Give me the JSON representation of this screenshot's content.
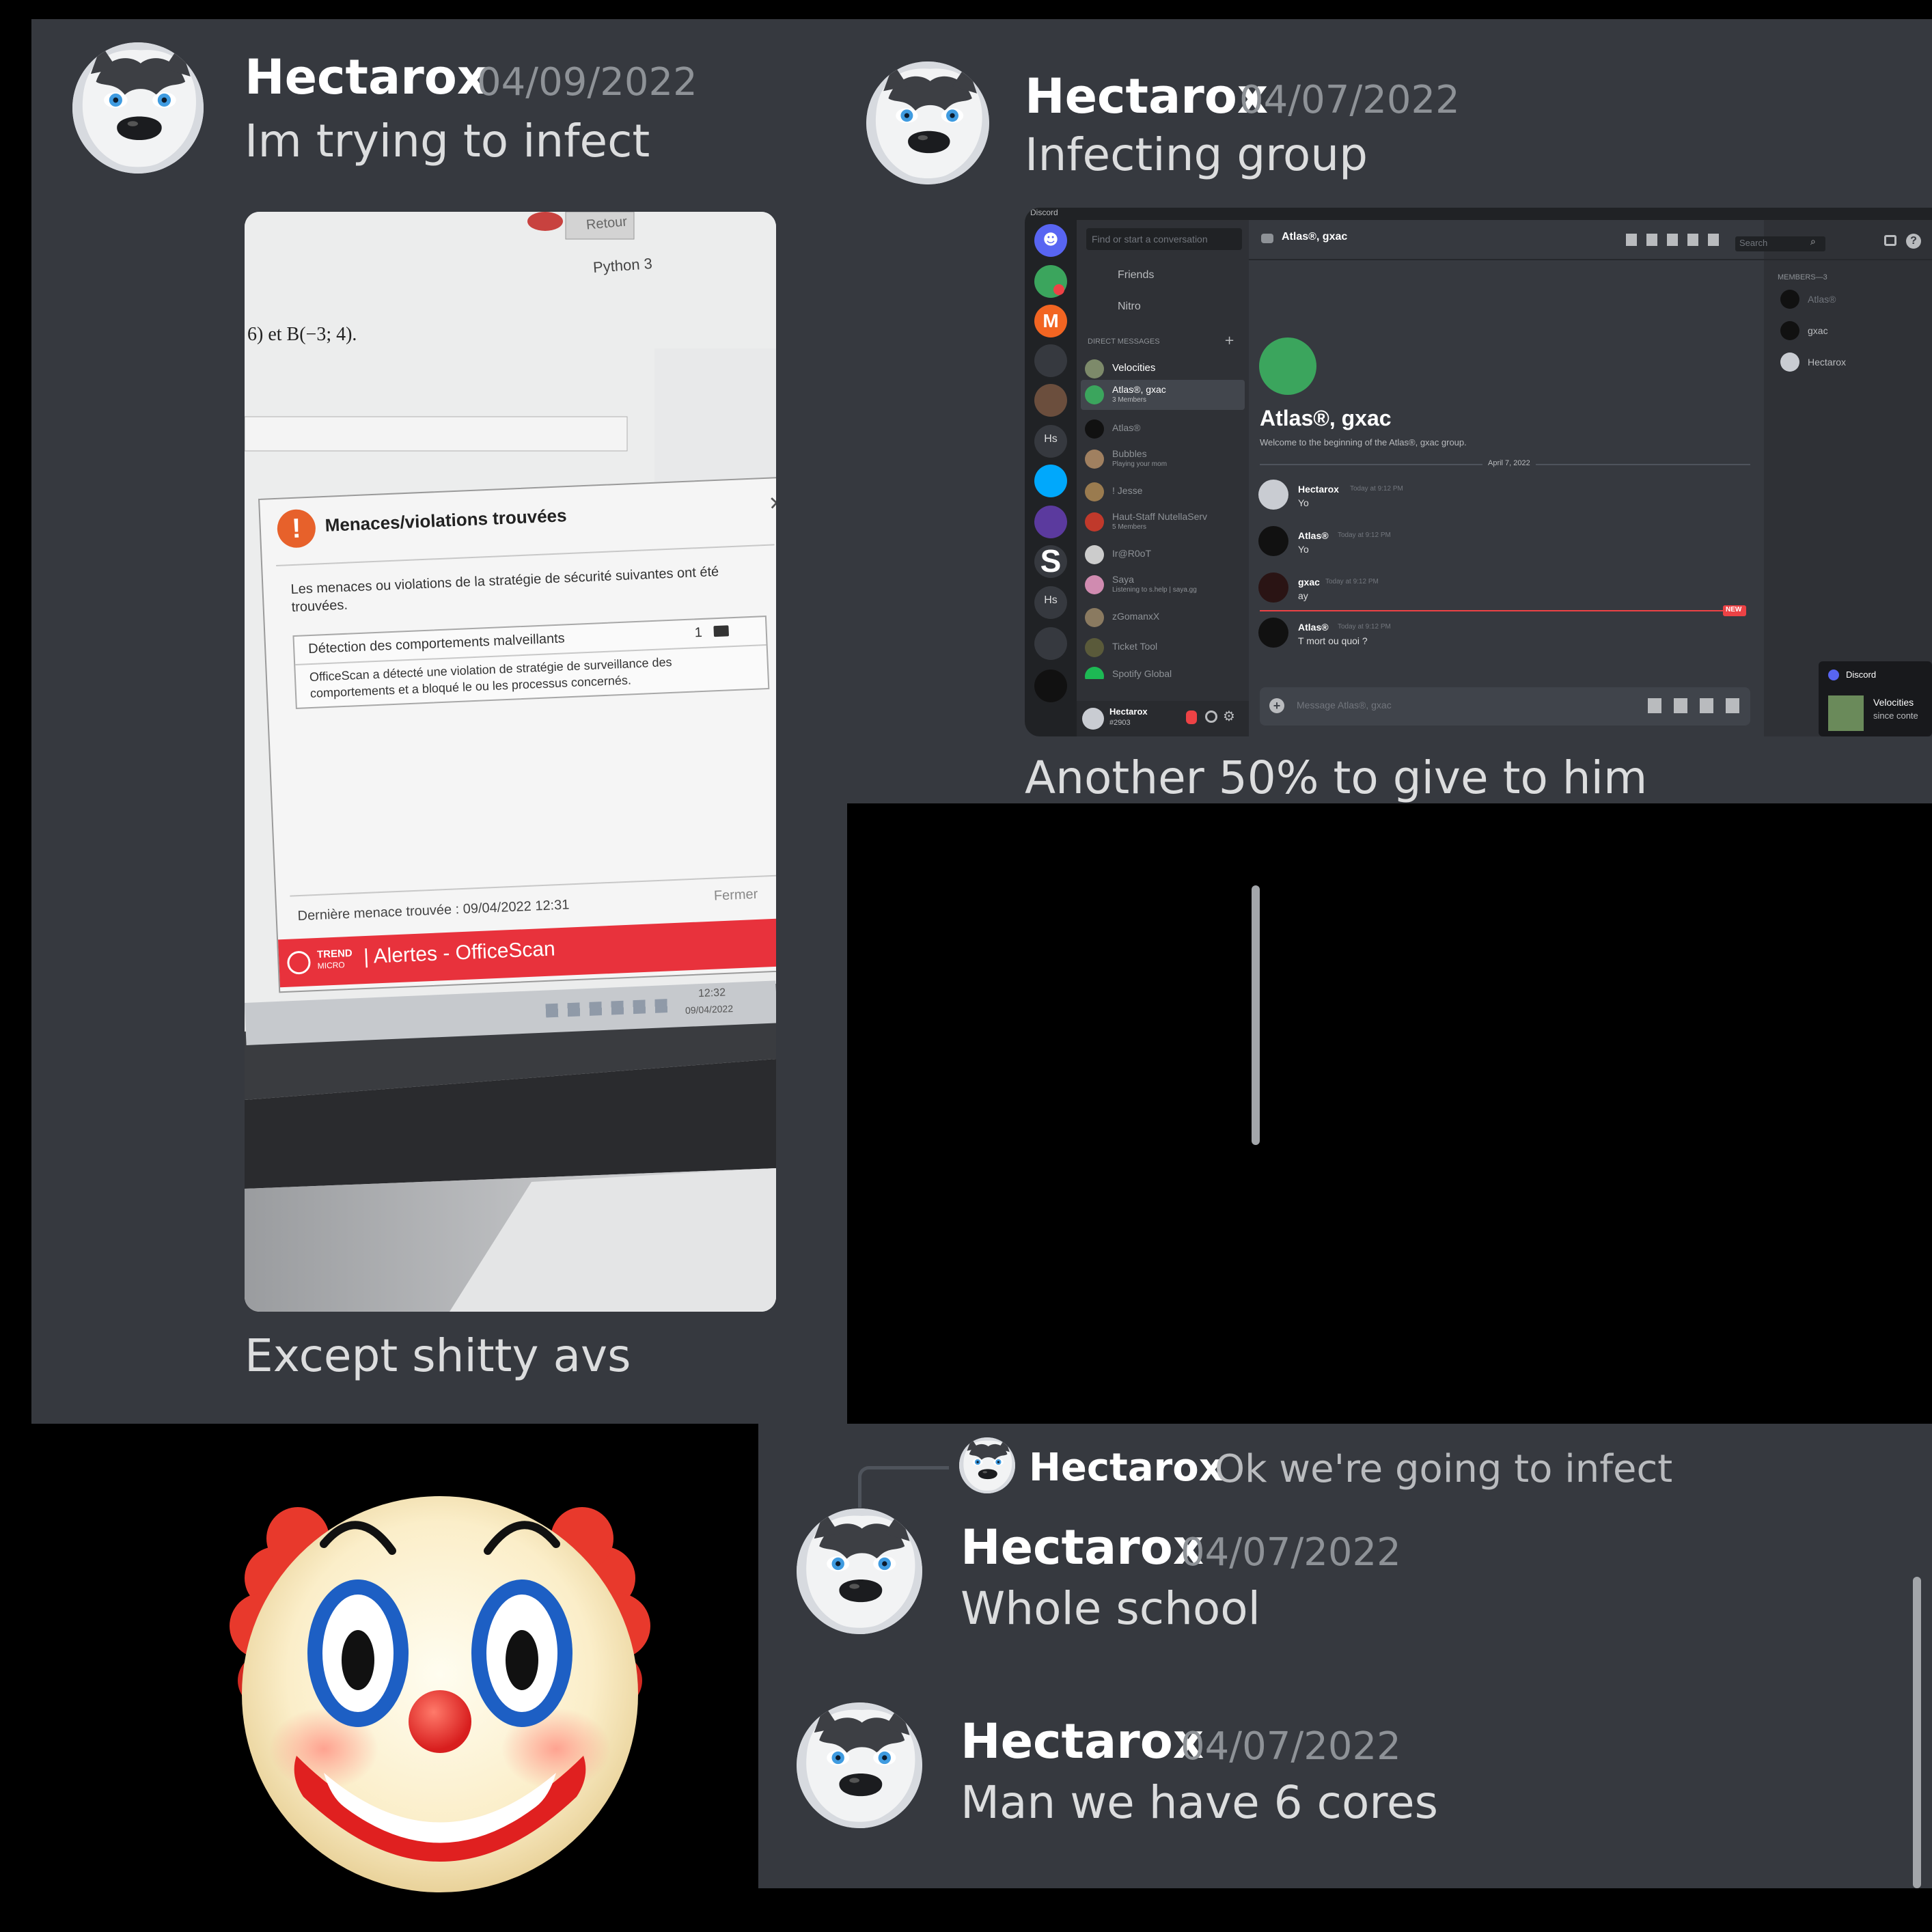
{
  "colors": {
    "background": "#000000",
    "chat_bg": "#36393f",
    "username": "#ffffff",
    "timestamp": "#8e9297",
    "message_text": "#dcddde",
    "alert_red": "#e8323c",
    "discord_blurple": "#5865f2",
    "group_green": "#3ba55d"
  },
  "messages": [
    {
      "author": "Hectarox",
      "date": "04/09/2022",
      "text": "Im trying to infect",
      "caption": "Except shitty avs"
    },
    {
      "author": "Hectarox",
      "date": "04/07/2022",
      "text": "Infecting group",
      "caption": "Another 50% to give to him"
    },
    {
      "reply_author": "Hectarox",
      "reply_text": "Ok we're going to infect",
      "author": "Hectarox",
      "date": "04/07/2022",
      "text": "Whole school"
    },
    {
      "author": "Hectarox",
      "date": "04/07/2022",
      "text": "Man we have 6 cores"
    }
  ],
  "photo": {
    "retour": "Retour",
    "python": "Python 3",
    "math": "6) et B(−3; 4).",
    "dialog_title": "Menaces/violations trouvées",
    "dialog_body": "Les menaces ou violations de la stratégie de sécurité suivantes ont été trouvées.",
    "row_label": "Détection des comportements malveillants",
    "row_count": "1",
    "row_desc_1": "OfficeScan a détecté une violation de stratégie de surveillance des",
    "row_desc_2": "comportements et a bloqué le ou les processus concernés.",
    "last_threat": "Dernière menace trouvée : 09/04/2022 12:31",
    "close": "Fermer",
    "brand_1": "TREND",
    "brand_2": "MICRO",
    "banner": "| Alertes - OfficeScan",
    "clock_time": "12:32",
    "clock_date": "09/04/2022"
  },
  "discord_shot": {
    "app_name": "Discord",
    "search_conv": "Find or start a conversation",
    "friends": "Friends",
    "nitro": "Nitro",
    "dm_header": "DIRECT MESSAGES",
    "dms": [
      {
        "name": "Velocities",
        "sub": ""
      },
      {
        "name": "Atlas®, gxac",
        "sub": "3 Members"
      },
      {
        "name": "Atlas®",
        "sub": ""
      },
      {
        "name": "Bubbles",
        "sub": "Playing your mom"
      },
      {
        "name": "! Jesse",
        "sub": ""
      },
      {
        "name": "Haut-Staff NutellaServ",
        "sub": "5 Members"
      },
      {
        "name": "Ir@R0oT",
        "sub": ""
      },
      {
        "name": "Saya",
        "sub": "Listening to s.help | saya.gg"
      },
      {
        "name": "zGomanxX",
        "sub": ""
      },
      {
        "name": "Ticket Tool",
        "sub": ""
      },
      {
        "name": "Spotify Global",
        "sub": ""
      }
    ],
    "user": "Hectarox",
    "user_tag": "#2903",
    "channel": "Atlas®, gxac",
    "search": "Search",
    "group_title": "Atlas®, gxac",
    "welcome": "Welcome to the beginning of the Atlas®, gxac group.",
    "date_divider": "April 7, 2022",
    "chat": [
      {
        "author": "Hectarox",
        "time": "Today at 9:12 PM",
        "text": "Yo"
      },
      {
        "author": "Atlas®",
        "time": "Today at 9:12 PM",
        "text": "Yo"
      },
      {
        "author": "gxac",
        "time": "Today at 9:12 PM",
        "text": "ay"
      },
      {
        "author": "Atlas®",
        "time": "Today at 9:12 PM",
        "text": "T mort ou quoi ?"
      }
    ],
    "new_badge": "NEW",
    "input_placeholder": "Message Atlas®, gxac",
    "members_header": "MEMBERS—3",
    "members": [
      "Atlas®",
      "gxac",
      "Hectarox"
    ],
    "toast_app": "Discord",
    "toast_name": "Velocities",
    "toast_sub": "since conte"
  }
}
